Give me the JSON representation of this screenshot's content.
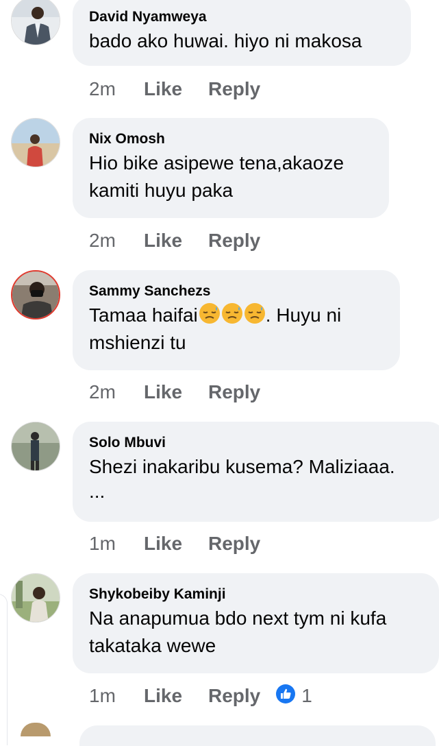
{
  "comments": [
    {
      "author": "David Nyamweya",
      "text": "bado ako huwai. hiyo ni makosa",
      "time": "2m",
      "like": "Like",
      "reply": "Reply"
    },
    {
      "author": "Nix Omosh",
      "text": "Hio bike asipewe tena,akaoze kamiti huyu paka",
      "time": "2m",
      "like": "Like",
      "reply": "Reply"
    },
    {
      "author": "Sammy Sanchezs",
      "text_before": "Tamaa haifai",
      "text_after": ". Huyu ni mshienzi tu",
      "emoji_icon": "downcast-face-with-sweat",
      "emoji_count": 3,
      "time": "2m",
      "like": "Like",
      "reply": "Reply"
    },
    {
      "author": "Solo Mbuvi",
      "text": "Shezi inakaribu kusema? Maliziaaa.",
      "text_more": "...",
      "time": "1m",
      "like": "Like",
      "reply": "Reply"
    },
    {
      "author": "Shykobeiby Kaminji",
      "text": "Na anapumua bdo next tym ni kufa takataka wewe",
      "time": "1m",
      "like": "Like",
      "reply": "Reply",
      "reaction_icon": "like-thumb-icon",
      "reaction_count": "1"
    }
  ],
  "colors": {
    "bubble": "#f0f2f5",
    "meta_text": "#65676b",
    "like_blue": "#1877f2"
  }
}
